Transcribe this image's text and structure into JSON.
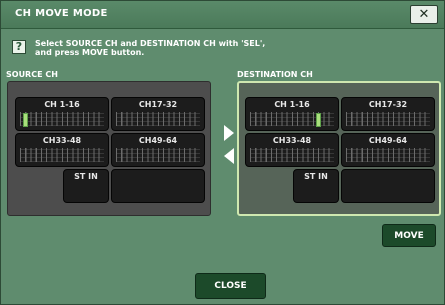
{
  "dialog": {
    "title": "CH MOVE MODE",
    "close_icon": "x-icon",
    "close_glyph": "✕",
    "help_glyph": "?",
    "instruction_line1": "Select SOURCE CH and DESTINATION CH with 'SEL',",
    "instruction_line2": "and press MOVE button."
  },
  "source": {
    "label": "SOURCE CH",
    "tiles": [
      "CH 1-16",
      "CH17-32",
      "CH33-48",
      "CH49-64"
    ],
    "stin": "ST IN"
  },
  "destination": {
    "label": "DESTINATION CH",
    "tiles": [
      "CH 1-16",
      "CH17-32",
      "CH33-48",
      "CH49-64"
    ],
    "stin": "ST IN"
  },
  "buttons": {
    "move": "MOVE",
    "close": "CLOSE"
  },
  "colors": {
    "background": "#5f8c6e",
    "panel": "#4d4d4d",
    "dest_highlight": "#cfe8b0",
    "button": "#1c4a2a"
  }
}
